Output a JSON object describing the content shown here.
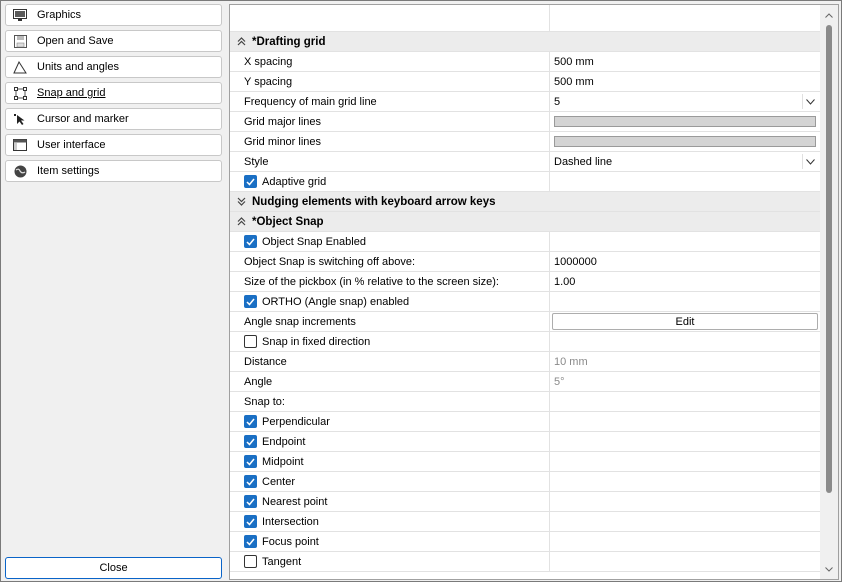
{
  "sidebar": {
    "items": [
      {
        "label": "Graphics",
        "icon": "monitor-icon"
      },
      {
        "label": "Open and Save",
        "icon": "save-disk-icon"
      },
      {
        "label": "Units and angles",
        "icon": "angle-icon"
      },
      {
        "label": "Snap and grid",
        "icon": "snap-grid-icon",
        "active": true
      },
      {
        "label": "Cursor and marker",
        "icon": "cursor-icon"
      },
      {
        "label": "User interface",
        "icon": "window-icon"
      },
      {
        "label": "Item settings",
        "icon": "globe-gear-icon"
      }
    ],
    "close_label": "Close"
  },
  "drafting": {
    "title": "*Drafting grid",
    "x_spacing": {
      "label": "X spacing",
      "value": "500 mm"
    },
    "y_spacing": {
      "label": "Y spacing",
      "value": "500 mm"
    },
    "frequency": {
      "label": "Frequency of main grid line",
      "value": "5"
    },
    "major": {
      "label": "Grid major lines"
    },
    "minor": {
      "label": "Grid minor lines"
    },
    "style": {
      "label": "Style",
      "value": "Dashed line"
    },
    "adaptive": {
      "label": "Adaptive grid",
      "checked": true
    }
  },
  "nudging": {
    "title": "Nudging elements with keyboard arrow keys"
  },
  "osnap": {
    "title": "*Object Snap",
    "enabled": {
      "label": "Object Snap Enabled",
      "checked": true
    },
    "switch_off": {
      "label": "Object Snap is switching off above:",
      "value": "1000000"
    },
    "pickbox": {
      "label": "Size of the pickbox (in % relative to the screen size):",
      "value": "1.00"
    },
    "ortho": {
      "label": "ORTHO (Angle snap) enabled",
      "checked": true
    },
    "angle_incr": {
      "label": "Angle snap increments",
      "button": "Edit"
    },
    "fixed_dir": {
      "label": "Snap in fixed direction",
      "checked": false
    },
    "distance": {
      "label": "Distance",
      "value": "10 mm"
    },
    "angle": {
      "label": "Angle",
      "value": "5°"
    },
    "snap_to_label": "Snap to:",
    "snap_to": [
      {
        "label": "Perpendicular",
        "checked": true
      },
      {
        "label": "Endpoint",
        "checked": true
      },
      {
        "label": "Midpoint",
        "checked": true
      },
      {
        "label": "Center",
        "checked": true
      },
      {
        "label": "Nearest point",
        "checked": true
      },
      {
        "label": "Intersection",
        "checked": true
      },
      {
        "label": "Focus point",
        "checked": true
      },
      {
        "label": "Tangent",
        "checked": false
      }
    ]
  },
  "colors": {
    "accent": "#1a6fc4",
    "section_bg": "#ececec"
  }
}
